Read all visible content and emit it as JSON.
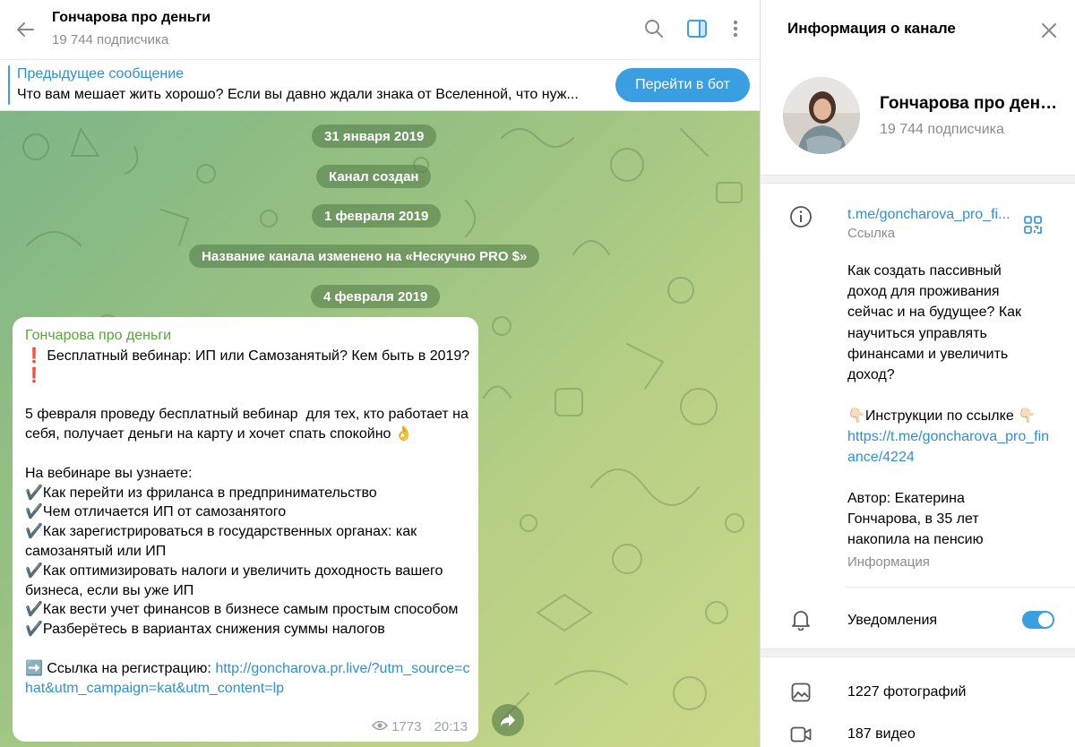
{
  "header": {
    "title": "Гончарова про деньги",
    "subtitle": "19 744 подписчика",
    "icons": [
      "back-arrow-icon",
      "search-icon",
      "sidebar-toggle-icon",
      "more-vertical-icon"
    ]
  },
  "pinned": {
    "title": "Предыдущее сообщение",
    "text": "Что вам мешает жить хорошо?  Если вы давно ждали знака от Вселенной, что нуж...",
    "button": "Перейти в бот"
  },
  "service": {
    "date1": "31 января 2019",
    "created": "Канал создан",
    "date2": "1 февраля 2019",
    "renamed": "Название канала изменено на «Нескучно PRO $»",
    "date3": "4 февраля 2019"
  },
  "message": {
    "author": "Гончарова про деньги",
    "line1": "❗ Бесплатный вебинар: ИП или Самозанятый? Кем быть в 2019?❗",
    "line2": "5 февраля проведу бесплатный вебинар  для тех, кто работает на себя, получает деньги на карту и хочет спать спокойно 👌",
    "list_title": "На вебинаре вы узнаете:",
    "items": [
      "✔️Как перейти из фриланса в предпринимательство",
      "✔️Чем отличается ИП от самозанятого",
      "✔️Как зарегистрироваться в государственных органах: как самозанятый или ИП",
      "✔️Как оптимизировать налоги и увеличить доходность вашего бизнеса, если вы уже ИП",
      "✔️Как вести учет финансов в бизнесе самым простым способом",
      "✔️Разберётесь в вариантах снижения суммы налогов"
    ],
    "reg_prefix": "➡️ Ссылка на регистрацию: ",
    "reg_link": "http://goncharova.pr.live/?utm_source=chat&utm_campaign=kat&utm_content=lp",
    "views": "1773",
    "time": "20:13"
  },
  "panel": {
    "title": "Информация о канале",
    "name": "Гончарова про деньги",
    "subscribers": "19 744 подписчика",
    "link": "t.me/goncharova_pro_fi...",
    "link_label": "Ссылка",
    "description_main": "Как создать пассивный доход для проживания сейчас и на будущее? Как научиться управлять финансами и увеличить доход?",
    "instructions": "👇🏻Инструкции по ссылке 👇🏻",
    "instructions_link": "https://t.me/goncharova_pro_finance/4224",
    "author": "Автор: Екатерина Гончарова, в 35 лет накопила на пенсию",
    "info_label": "Информация",
    "notifications": "Уведомления",
    "notifications_on": true,
    "photos": "1227 фотографий",
    "videos": "187 видео"
  },
  "colors": {
    "accent": "#3a9fe0",
    "author_green": "#5aa53d",
    "link_blue": "#2e8fd8"
  }
}
